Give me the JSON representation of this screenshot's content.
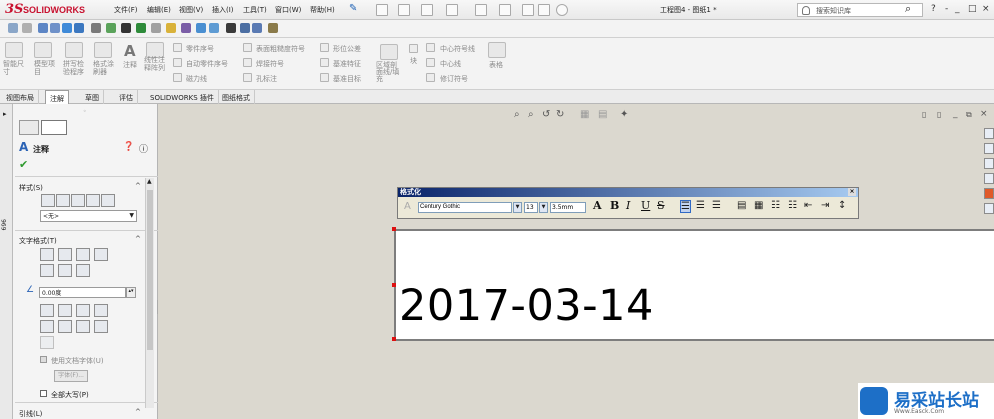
{
  "app": {
    "logo_ds": "3S",
    "logo_text": "SOLIDWORKS",
    "menus": [
      "文件(F)",
      "编辑(E)",
      "视图(V)",
      "插入(I)",
      "工具(T)",
      "窗口(W)",
      "帮助(H)"
    ],
    "doc_title": "工程图4 - 图纸1 *",
    "search_placeholder": "搜索知识库",
    "win_controls": [
      "?",
      "-",
      "_",
      "□",
      "×"
    ]
  },
  "ribbon": {
    "smart_dim": "智能尺\n寸",
    "model_items": "模型项\n目",
    "spell_check": "拼写检\n验程序",
    "format_painter": "格式涂\n刷器",
    "note": "注释",
    "linear_note": "线性注\n释阵列",
    "balloon": "零件序号",
    "auto_balloon": "自动零件序号",
    "magnetic_line": "磁力线",
    "surface_finish": "表面粗糙度符号",
    "weld_symbol": "焊接符号",
    "hole_callout": "孔标注",
    "geo_tol": "形位公差",
    "datum_feature": "基准特征",
    "datum_target": "基准目标",
    "blocks": "块",
    "area_hatch": "区域剖\n面线/填\n充",
    "center_mark": "中心符号线",
    "centerline": "中心线",
    "revision_symbol": "修订符号",
    "tables": "表格"
  },
  "tabs": [
    "视图布局",
    "注解",
    "草图",
    "评估",
    "SOLIDWORKS 插件",
    "图纸格式"
  ],
  "active_tab": "注解",
  "panel": {
    "title": "注释",
    "style_section": "样式(S)",
    "style_value": "<无>",
    "text_format_section": "文字格式(T)",
    "angle_value": "0.00度",
    "use_doc_font": "使用文档字体(U)",
    "font_button": "字体(F)...",
    "all_caps": "全部大写(P)",
    "leader_section": "引线(L)",
    "side_label": "696"
  },
  "format_toolbar": {
    "title": "格式化",
    "font": "Century Gothic",
    "size": "13",
    "height": "3.5mm"
  },
  "note_text": "2017-03-14",
  "watermark": {
    "text": "易采站长站",
    "url": "Www.Easck.Com"
  }
}
